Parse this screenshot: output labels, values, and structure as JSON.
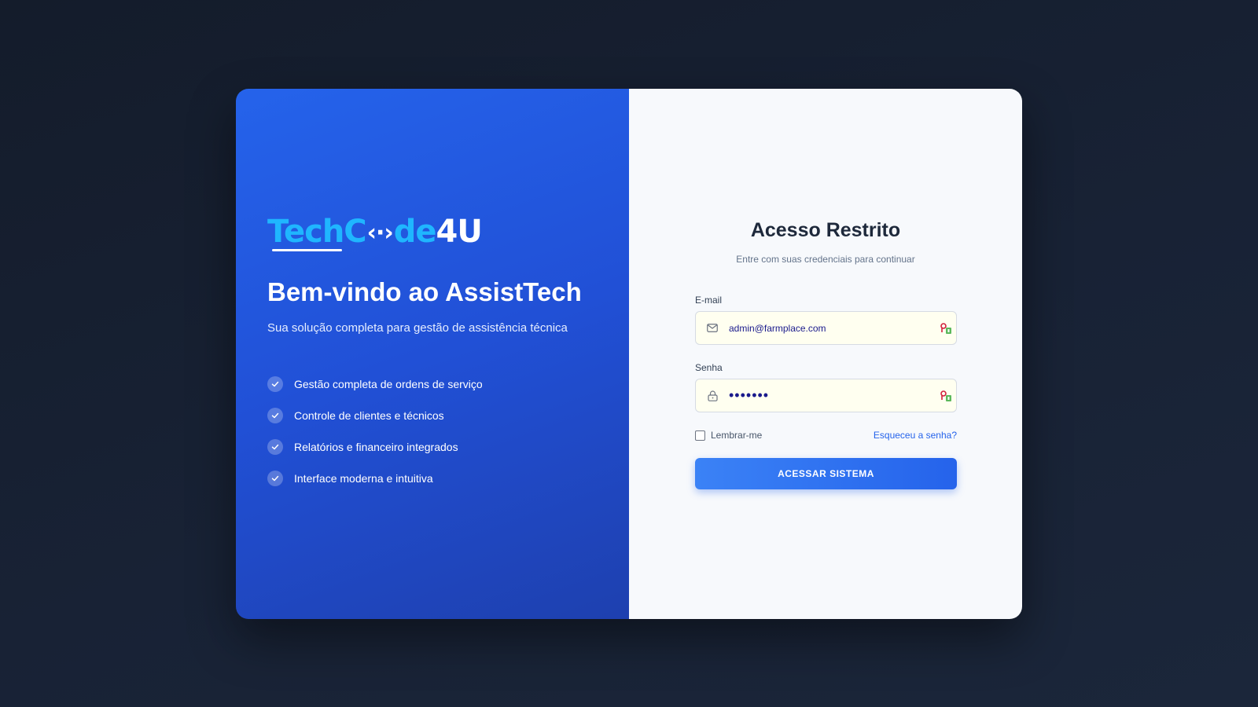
{
  "brand": {
    "logo_part1": "Tech",
    "logo_part2": "C",
    "logo_brackets": "‹·›",
    "logo_part3": "de",
    "logo_part4": "4U"
  },
  "left": {
    "welcome": "Bem-vindo ao AssistTech",
    "tagline": "Sua solução completa para gestão de assistência técnica",
    "features": [
      "Gestão completa de ordens de serviço",
      "Controle de clientes e técnicos",
      "Relatórios e financeiro integrados",
      "Interface moderna e intuitiva"
    ]
  },
  "form": {
    "title": "Acesso Restrito",
    "subtitle": "Entre com suas credenciais para continuar",
    "email_label": "E-mail",
    "email_value": "admin@farmplace.com",
    "password_label": "Senha",
    "password_value": "•••••••",
    "remember_label": "Lembrar-me",
    "forgot_label": "Esqueceu a senha?",
    "submit_label": "ACESSAR SISTEMA"
  },
  "icons": {
    "email": "mail-icon",
    "password": "lock-icon",
    "autofill": "password-manager-icon",
    "feature": "check-icon"
  },
  "colors": {
    "primary": "#2563eb",
    "accent": "#1fb6ff",
    "background": "#161e2e"
  }
}
